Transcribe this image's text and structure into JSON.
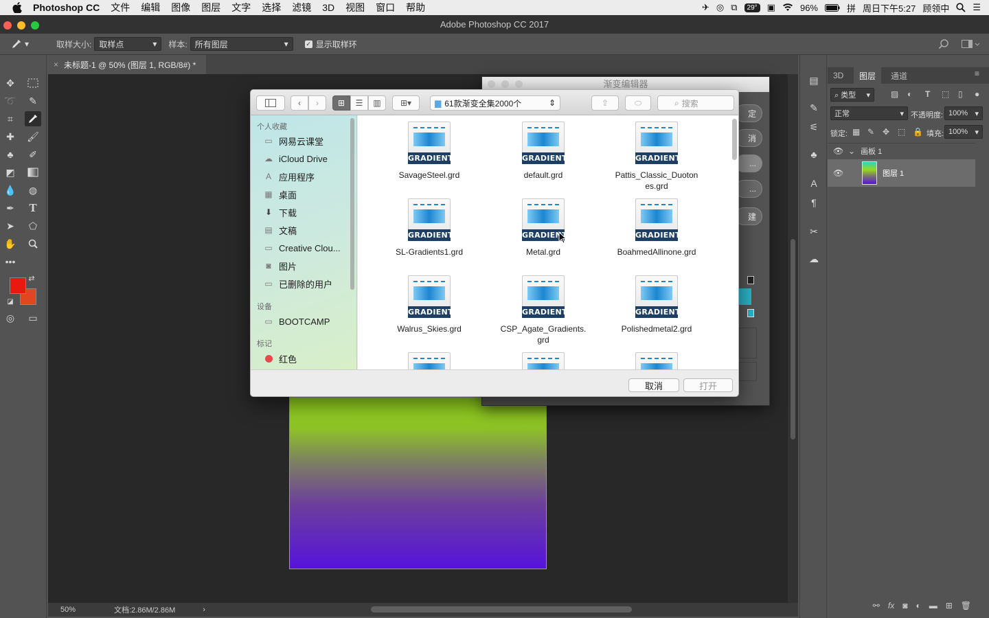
{
  "menubar": {
    "app": "Photoshop CC",
    "items": [
      "文件",
      "编辑",
      "图像",
      "图层",
      "文字",
      "选择",
      "滤镜",
      "3D",
      "视图",
      "窗口",
      "帮助"
    ],
    "temp": "29°",
    "battery": "96%",
    "datetime": "周日下午5:27",
    "user": "顾领中",
    "input_method": "拼"
  },
  "window": {
    "title": "Adobe Photoshop CC 2017"
  },
  "options": {
    "sample_size_label": "取样大小:",
    "sample_size_value": "取样点",
    "sample_label": "样本:",
    "sample_value": "所有图层",
    "show_ring_label": "显示取样环"
  },
  "document": {
    "tab_title": "未标题-1 @ 50% (图层 1, RGB/8#) *",
    "zoom": "50%",
    "doc_size": "文档:2.86M/2.86M"
  },
  "colors": {
    "foreground": "#e8190f",
    "background": "#e0471f"
  },
  "layers_panel": {
    "tabs": [
      "3D",
      "图层",
      "通道"
    ],
    "filter": "类型",
    "blend_mode": "正常",
    "opacity_label": "不透明度:",
    "opacity": "100%",
    "lock_label": "锁定:",
    "fill_label": "填充:",
    "fill": "100%",
    "artboard": "画板 1",
    "layer": "图层 1"
  },
  "gradient_editor": {
    "title": "渐变编辑器",
    "buttons": [
      "定",
      "消",
      "...",
      "...",
      "建"
    ]
  },
  "dialog": {
    "path": "61款渐变全集2000个",
    "search_placeholder": "搜索",
    "favorites_head": "个人收藏",
    "favorites": [
      {
        "label": "网易云课堂",
        "icon": "folder-icon"
      },
      {
        "label": "iCloud Drive",
        "icon": "cloud-icon"
      },
      {
        "label": "应用程序",
        "icon": "applications-icon"
      },
      {
        "label": "桌面",
        "icon": "desktop-icon"
      },
      {
        "label": "下载",
        "icon": "download-icon"
      },
      {
        "label": "文稿",
        "icon": "documents-icon"
      },
      {
        "label": "Creative Clou...",
        "icon": "folder-icon"
      },
      {
        "label": "图片",
        "icon": "camera-icon"
      },
      {
        "label": "已删除的用户",
        "icon": "folder-icon"
      }
    ],
    "devices_head": "设备",
    "devices": [
      {
        "label": "BOOTCAMP",
        "icon": "disk-icon"
      }
    ],
    "tags_head": "标记",
    "tags": [
      {
        "label": "红色",
        "color": "#e5484d"
      }
    ],
    "icon_label": "GRADIENT",
    "files": [
      "SavageSteel.grd",
      "default.grd",
      "Pattis_Classic_Duotones.grd",
      "SL-Gradients1.grd",
      "Metal.grd",
      "BoahmedAllinone.grd",
      "Walrus_Skies.grd",
      "CSP_Agate_Gradients.grd",
      "Polishedmetal2.grd",
      "",
      "",
      ""
    ],
    "cancel": "取消",
    "open": "打开"
  }
}
